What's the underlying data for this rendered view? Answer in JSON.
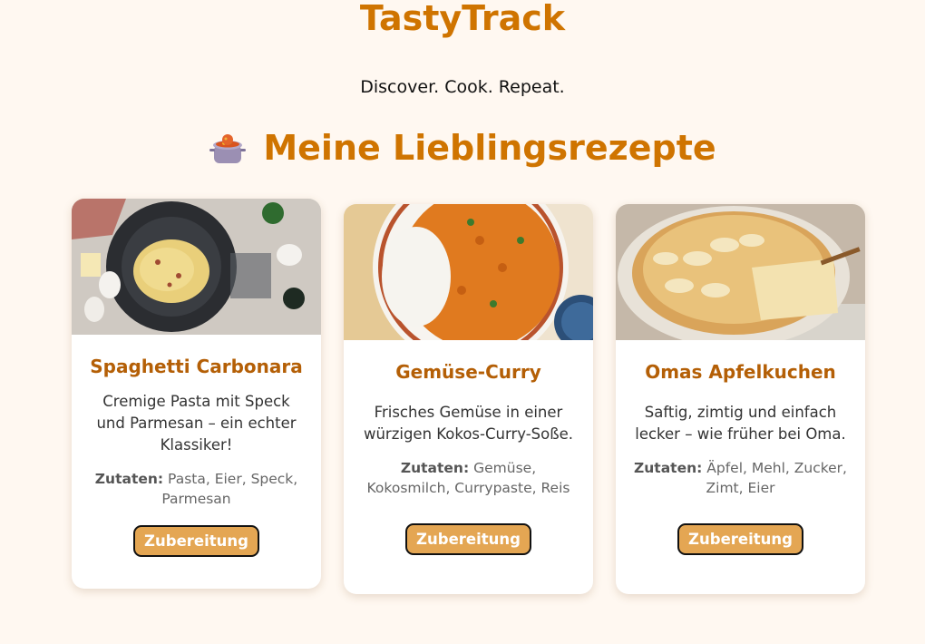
{
  "header": {
    "brand": "TastyTrack",
    "tagline": "Discover. Cook. Repeat."
  },
  "section": {
    "title": "Meine Lieblingsrezepte",
    "icon": "cooking-pot-icon"
  },
  "recipes": [
    {
      "title": "Spaghetti Carbonara",
      "description": "Cremige Pasta mit Speck und Parmesan – ein echter Klassiker!",
      "ingredients_label": "Zutaten:",
      "ingredients": "Pasta, Eier, Speck, Parmesan",
      "button": "Zubereitung"
    },
    {
      "title": "Gemüse-Curry",
      "description": "Frisches Gemüse in einer würzigen Kokos-Curry-Soße.",
      "ingredients_label": "Zutaten:",
      "ingredients": "Gemüse, Kokosmilch, Currypaste, Reis",
      "button": "Zubereitung"
    },
    {
      "title": "Omas Apfelkuchen",
      "description": "Saftig, zimtig und einfach lecker – wie früher bei Oma.",
      "ingredients_label": "Zutaten:",
      "ingredients": "Äpfel, Mehl, Zucker, Zimt, Eier",
      "button": "Zubereitung"
    }
  ],
  "colors": {
    "accent": "#cf7400",
    "card_title": "#b45f06",
    "button": "#e4a653",
    "background": "#fff8f1"
  }
}
